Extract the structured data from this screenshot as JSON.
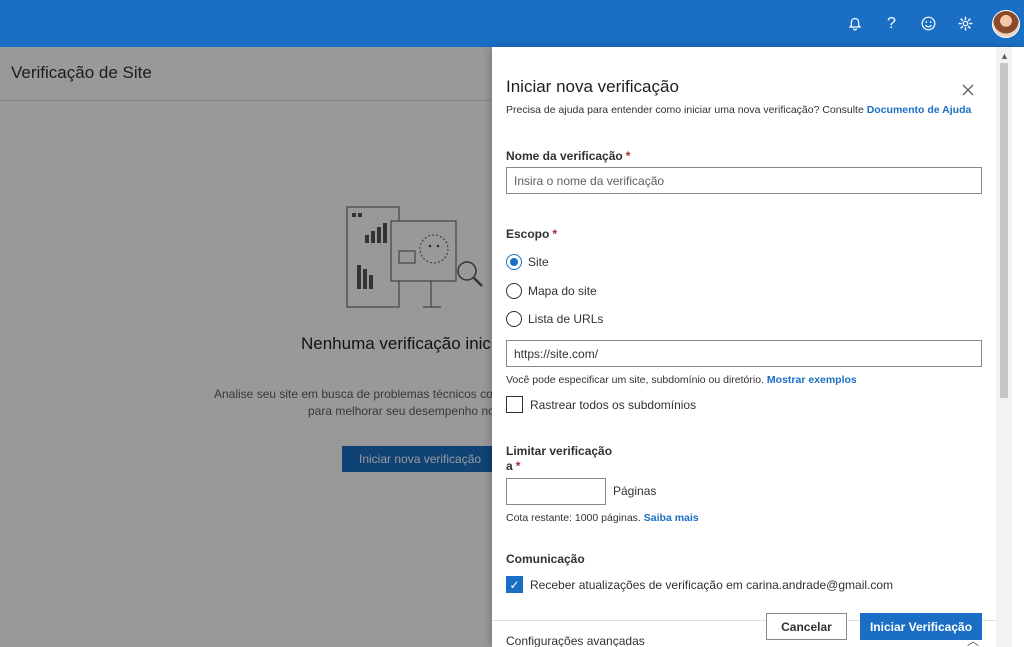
{
  "topbar": {
    "icons": [
      "bell-icon",
      "help-icon",
      "feedback-smiley-icon",
      "gear-icon"
    ],
    "accent": "#1a6fc4"
  },
  "page": {
    "title": "Verificação de Site",
    "empty_title": "Nenhuma verificação inic",
    "empty_desc_line1": "Analise seu site em busca de problemas técnicos com",
    "empty_desc_line2": "para melhorar seu desempenho no",
    "empty_button": "Iniciar nova verificação"
  },
  "panel": {
    "title": "Iniciar nova verificação",
    "help_text": "Precisa de ajuda para entender como iniciar uma nova verificação? Consulte",
    "help_link": "Documento de Ajuda",
    "name_label": "Nome da verificação",
    "name_placeholder": "Insira o nome da verificação",
    "scope_label": "Escopo",
    "scope_options": [
      "Site",
      "Mapa do site",
      "Lista de URLs"
    ],
    "scope_selected": "Site",
    "url_value": "https://site.com/",
    "url_hint": "Você pode especificar um site, subdomínio ou diretório.",
    "url_hint_link": "Mostrar exemplos",
    "subdomains_label": "Rastrear todos os subdomínios",
    "limit_label_line1": "Limitar verificação",
    "limit_label_line2": "a",
    "limit_value": "",
    "pages_label": "Páginas",
    "quota_text": "Cota restante: 1000 páginas.",
    "quota_link": "Saiba mais",
    "communication_label": "Comunicação",
    "email_checkbox_label": "Receber atualizações de verificação em carina.andrade@gmail.com",
    "advanced_label": "Configurações avançadas",
    "cancel_label": "Cancelar",
    "submit_label": "Iniciar Verificação",
    "required_mark": "*"
  }
}
